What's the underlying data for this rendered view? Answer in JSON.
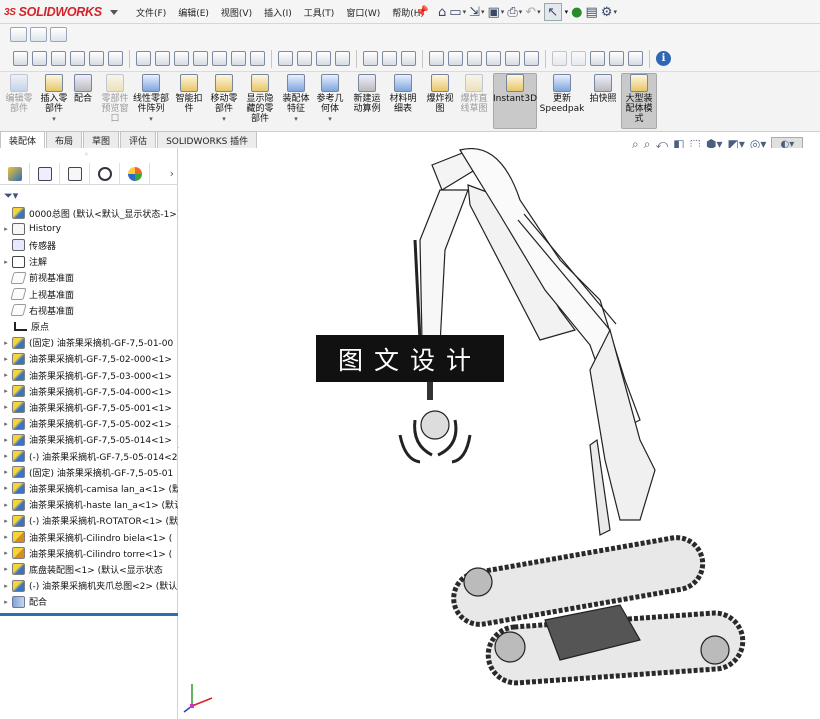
{
  "app": {
    "brand": "SOLIDWORKS",
    "brand_prefix": "3S"
  },
  "menu": [
    "文件(F)",
    "编辑(E)",
    "视图(V)",
    "插入(I)",
    "工具(T)",
    "窗口(W)",
    "帮助(H)"
  ],
  "command_manager": [
    {
      "label": "编辑零\n部件",
      "enabled": false
    },
    {
      "label": "插入零\n部件",
      "enabled": true,
      "dropdown": true
    },
    {
      "label": "配合",
      "enabled": true
    },
    {
      "label": "零部件\n预览窗\n口",
      "enabled": false
    },
    {
      "label": "线性零部\n件阵列",
      "enabled": true,
      "dropdown": true
    },
    {
      "label": "智能扣\n件",
      "enabled": true
    },
    {
      "label": "移动零\n部件",
      "enabled": true,
      "dropdown": true
    },
    {
      "label": "显示隐\n藏的零\n部件",
      "enabled": true
    },
    {
      "label": "装配体\n特征",
      "enabled": true,
      "dropdown": true
    },
    {
      "label": "参考几\n何体",
      "enabled": true,
      "dropdown": true
    },
    {
      "label": "新建运\n动算例",
      "enabled": true
    },
    {
      "label": "材料明\n细表",
      "enabled": true
    },
    {
      "label": "爆炸视\n图",
      "enabled": true
    },
    {
      "label": "爆炸直\n线草图",
      "enabled": false
    },
    {
      "label": "Instant3D",
      "enabled": true,
      "selected": true
    },
    {
      "label": "更新\nSpeedpak",
      "enabled": true
    },
    {
      "label": "拍快照",
      "enabled": true
    },
    {
      "label": "大型装\n配体模\n式",
      "enabled": true,
      "selected": true
    }
  ],
  "tabs": [
    "装配体",
    "布局",
    "草图",
    "评估",
    "SOLIDWORKS 插件"
  ],
  "active_tab": "装配体",
  "tree": [
    {
      "label": "0000总图  (默认<默认_显示状态-1>)",
      "icon": "assembly-icon",
      "exp": ""
    },
    {
      "label": "History",
      "icon": "history-icon",
      "exp": "▸"
    },
    {
      "label": "传感器",
      "icon": "sensor-icon",
      "exp": ""
    },
    {
      "label": "注解",
      "icon": "annotation-icon",
      "exp": "▸"
    },
    {
      "label": "前视基准面",
      "icon": "plane-icon",
      "exp": ""
    },
    {
      "label": "上视基准面",
      "icon": "plane-icon",
      "exp": ""
    },
    {
      "label": "右视基准面",
      "icon": "plane-icon",
      "exp": ""
    },
    {
      "label": "原点",
      "icon": "origin-icon",
      "exp": ""
    },
    {
      "label": "(固定) 油茶果采摘机-GF-7,5-01-00",
      "icon": "assembly-icon",
      "exp": "▸"
    },
    {
      "label": "油茶果采摘机-GF-7,5-02-000<1>",
      "icon": "assembly-icon",
      "exp": "▸"
    },
    {
      "label": "油茶果采摘机-GF-7,5-03-000<1>",
      "icon": "assembly-icon",
      "exp": "▸"
    },
    {
      "label": "油茶果采摘机-GF-7,5-04-000<1>",
      "icon": "assembly-icon",
      "exp": "▸"
    },
    {
      "label": "油茶果采摘机-GF-7,5-05-001<1>",
      "icon": "assembly-icon",
      "exp": "▸"
    },
    {
      "label": "油茶果采摘机-GF-7,5-05-002<1>",
      "icon": "assembly-icon",
      "exp": "▸"
    },
    {
      "label": "油茶果采摘机-GF-7,5-05-014<1>",
      "icon": "assembly-icon",
      "exp": "▸"
    },
    {
      "label": "(-) 油茶果采摘机-GF-7,5-05-014<2",
      "icon": "assembly-icon",
      "exp": "▸"
    },
    {
      "label": "(固定) 油茶果采摘机-GF-7,5-05-01",
      "icon": "assembly-icon",
      "exp": "▸"
    },
    {
      "label": "油茶果采摘机-camisa lan_a<1> (默",
      "icon": "assembly-icon",
      "exp": "▸"
    },
    {
      "label": "油茶果采摘机-haste lan_a<1> (默认",
      "icon": "assembly-icon",
      "exp": "▸"
    },
    {
      "label": "(-) 油茶果采摘机-ROTATOR<1> (默",
      "icon": "assembly-icon",
      "exp": "▸"
    },
    {
      "label": "油茶果采摘机-Cilindro biela<1> (",
      "icon": "part-icon",
      "exp": "▸"
    },
    {
      "label": "油茶果采摘机-Cilindro torre<1> (",
      "icon": "part-icon",
      "exp": "▸"
    },
    {
      "label": "底盘装配图<1> (默认<显示状态",
      "icon": "assembly-icon",
      "exp": "▸"
    },
    {
      "label": "(-) 油茶果采摘机夹爪总图<2> (默认",
      "icon": "assembly-icon",
      "exp": "▸"
    },
    {
      "label": "配合",
      "icon": "mate-icon",
      "exp": "▸"
    }
  ],
  "viewport": {
    "watermark": "图文设计"
  }
}
